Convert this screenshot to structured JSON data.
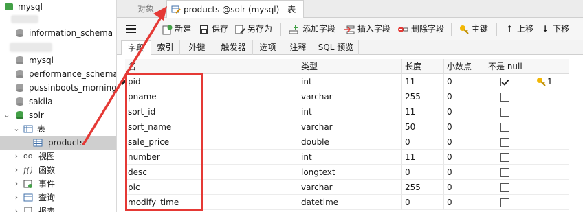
{
  "sidebar": {
    "connection": "mysql",
    "databases": [
      {
        "label": "information_schema"
      },
      {
        "label": "mysql"
      },
      {
        "label": "performance_schema"
      },
      {
        "label": "pussinboots_morning"
      },
      {
        "label": "sakila"
      },
      {
        "label": "solr"
      }
    ],
    "tables_label": "表",
    "selected_table": "products",
    "groups": [
      {
        "label": "视图"
      },
      {
        "label": "函数"
      },
      {
        "label": "事件"
      },
      {
        "label": "查询"
      },
      {
        "label": "报表"
      }
    ]
  },
  "tabs": {
    "objects": "对象",
    "active": "products @solr (mysql) - 表"
  },
  "toolbar": {
    "new": "新建",
    "save": "保存",
    "save_as": "另存为",
    "add_field": "添加字段",
    "insert_field": "插入字段",
    "delete_field": "删除字段",
    "primary_key": "主键",
    "move_up": "上移",
    "move_down": "下移"
  },
  "subtabs": [
    "字段",
    "索引",
    "外键",
    "触发器",
    "选项",
    "注释",
    "SQL 预览"
  ],
  "grid": {
    "headers": {
      "name": "名",
      "type": "类型",
      "length": "长度",
      "decimals": "小数点",
      "not_null": "不是 null",
      "key": ""
    },
    "rows": [
      {
        "name": "pid",
        "type": "int",
        "length": "11",
        "decimals": "0",
        "not_null": true,
        "key": "1"
      },
      {
        "name": "pname",
        "type": "varchar",
        "length": "255",
        "decimals": "0",
        "not_null": false,
        "key": ""
      },
      {
        "name": "sort_id",
        "type": "int",
        "length": "11",
        "decimals": "0",
        "not_null": false,
        "key": ""
      },
      {
        "name": "sort_name",
        "type": "varchar",
        "length": "50",
        "decimals": "0",
        "not_null": false,
        "key": ""
      },
      {
        "name": "sale_price",
        "type": "double",
        "length": "0",
        "decimals": "0",
        "not_null": false,
        "key": ""
      },
      {
        "name": "number",
        "type": "int",
        "length": "11",
        "decimals": "0",
        "not_null": false,
        "key": ""
      },
      {
        "name": "desc",
        "type": "longtext",
        "length": "0",
        "decimals": "0",
        "not_null": false,
        "key": ""
      },
      {
        "name": "pic",
        "type": "varchar",
        "length": "255",
        "decimals": "0",
        "not_null": false,
        "key": ""
      },
      {
        "name": "modify_time",
        "type": "datetime",
        "length": "0",
        "decimals": "0",
        "not_null": false,
        "key": ""
      }
    ]
  },
  "colors": {
    "annotation": "#e53935",
    "db_icon": "#9e9e9e",
    "solr_icon": "#43a047",
    "key_icon": "#f2b705"
  }
}
